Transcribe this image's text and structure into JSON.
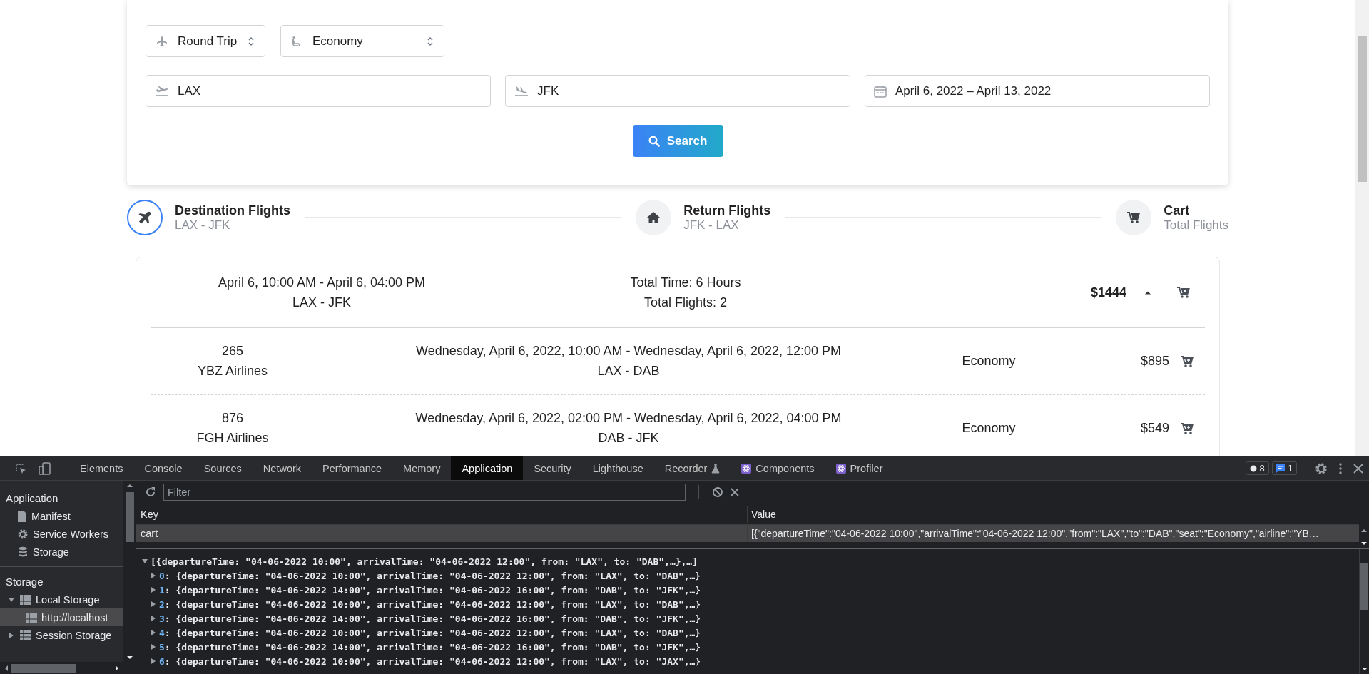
{
  "search_form": {
    "trip_type": "Round Trip",
    "cabin": "Economy",
    "from": "LAX",
    "to": "JFK",
    "dates": "April 6, 2022 – April 13, 2022",
    "search_button": "Search"
  },
  "steps": [
    {
      "title": "Destination Flights",
      "subtitle": "LAX - JFK",
      "kind": "plane",
      "selected": true
    },
    {
      "title": "Return Flights",
      "subtitle": "JFK - LAX",
      "kind": "home",
      "selected": false
    },
    {
      "title": "Cart",
      "subtitle": "Total Flights",
      "kind": "cart",
      "selected": false
    }
  ],
  "flight_group": {
    "times": "April 6, 10:00 AM - April 6, 04:00 PM",
    "route": "LAX - JFK",
    "total_time": "Total Time: 6 Hours",
    "total_flights": "Total Flights: 2",
    "price": "$1444",
    "expanded": true,
    "legs": [
      {
        "number": "265",
        "airline": "YBZ Airlines",
        "times": "Wednesday, April 6, 2022, 10:00 AM - Wednesday, April 6, 2022, 12:00 PM",
        "route": "LAX - DAB",
        "seat": "Economy",
        "price": "$895"
      },
      {
        "number": "876",
        "airline": "FGH Airlines",
        "times": "Wednesday, April 6, 2022, 02:00 PM - Wednesday, April 6, 2022, 04:00 PM",
        "route": "DAB - JFK",
        "seat": "Economy",
        "price": "$549"
      }
    ]
  },
  "devtools": {
    "tabs": [
      {
        "label": "Elements",
        "kind": "plain",
        "selected": false
      },
      {
        "label": "Console",
        "kind": "plain",
        "selected": false
      },
      {
        "label": "Sources",
        "kind": "plain",
        "selected": false
      },
      {
        "label": "Network",
        "kind": "plain",
        "selected": false
      },
      {
        "label": "Performance",
        "kind": "plain",
        "selected": false
      },
      {
        "label": "Memory",
        "kind": "plain",
        "selected": false
      },
      {
        "label": "Application",
        "kind": "plain",
        "selected": true
      },
      {
        "label": "Security",
        "kind": "plain",
        "selected": false
      },
      {
        "label": "Lighthouse",
        "kind": "plain",
        "selected": false
      },
      {
        "label": "Recorder",
        "kind": "flask",
        "selected": false
      },
      {
        "label": "Components",
        "kind": "react",
        "selected": false
      },
      {
        "label": "Profiler",
        "kind": "react",
        "selected": false
      }
    ],
    "error_count": "8",
    "message_count": "1",
    "sidebar": [
      {
        "heading": "Application",
        "items": [
          {
            "label": "Manifest",
            "kind": "file",
            "selected": false
          },
          {
            "label": "Service Workers",
            "kind": "gear",
            "selected": false
          },
          {
            "label": "Storage",
            "kind": "database",
            "selected": false
          }
        ]
      },
      {
        "heading": "Storage",
        "items": [
          {
            "label": "Local Storage",
            "kind": "grid",
            "expanded": true,
            "selected": false,
            "children": [
              {
                "label": "http://localhost",
                "kind": "grid",
                "selected": true
              }
            ]
          },
          {
            "label": "Session Storage",
            "kind": "grid",
            "expanded": false,
            "selected": false
          }
        ]
      }
    ],
    "filter": {
      "placeholder": "Filter"
    },
    "table": {
      "columns": [
        "Key",
        "Value"
      ],
      "rows": [
        {
          "key": "cart",
          "value": "[{\"departureTime\":\"04-06-2022 10:00\",\"arrivalTime\":\"04-06-2022 12:00\",\"from\":\"LAX\",\"to\":\"DAB\",\"seat\":\"Economy\",\"airline\":\"YB…",
          "selected": true
        }
      ]
    },
    "preview": {
      "summary": "[{departureTime: \"04-06-2022 10:00\", arrivalTime: \"04-06-2022 12:00\", from: \"LAX\", to: \"DAB\",…},…]",
      "expanded": true,
      "items": [
        {
          "index": "0",
          "text": ": {departureTime: \"04-06-2022 10:00\", arrivalTime: \"04-06-2022 12:00\", from: \"LAX\", to: \"DAB\",…}",
          "expanded": false
        },
        {
          "index": "1",
          "text": ": {departureTime: \"04-06-2022 14:00\", arrivalTime: \"04-06-2022 16:00\", from: \"DAB\", to: \"JFK\",…}",
          "expanded": false
        },
        {
          "index": "2",
          "text": ": {departureTime: \"04-06-2022 10:00\", arrivalTime: \"04-06-2022 12:00\", from: \"LAX\", to: \"DAB\",…}",
          "expanded": false
        },
        {
          "index": "3",
          "text": ": {departureTime: \"04-06-2022 14:00\", arrivalTime: \"04-06-2022 16:00\", from: \"DAB\", to: \"JFK\",…}",
          "expanded": false
        },
        {
          "index": "4",
          "text": ": {departureTime: \"04-06-2022 10:00\", arrivalTime: \"04-06-2022 12:00\", from: \"LAX\", to: \"DAB\",…}",
          "expanded": false
        },
        {
          "index": "5",
          "text": ": {departureTime: \"04-06-2022 14:00\", arrivalTime: \"04-06-2022 16:00\", from: \"DAB\", to: \"JFK\",…}",
          "expanded": false
        },
        {
          "index": "6",
          "text": ": {departureTime: \"04-06-2022 10:00\", arrivalTime: \"04-06-2022 12:00\", from: \"LAX\", to: \"JAX\",…}",
          "expanded": false
        }
      ]
    }
  }
}
